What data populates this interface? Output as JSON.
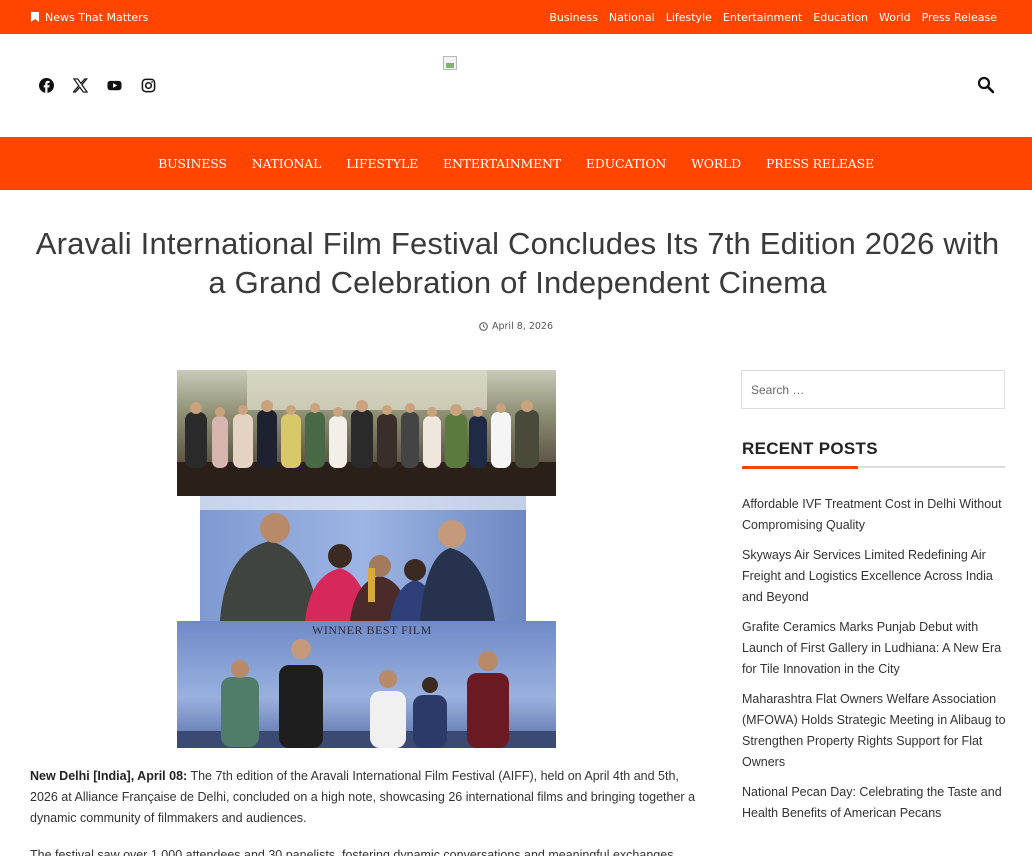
{
  "topbar": {
    "tagline": "News That Matters",
    "links": [
      "Business",
      "National",
      "Lifestyle",
      "Entertainment",
      "Education",
      "World",
      "Press Release"
    ]
  },
  "header": {
    "social_icons": [
      "facebook-icon",
      "x-icon",
      "youtube-icon",
      "instagram-icon"
    ],
    "logo_icon": "broken-image-icon",
    "search_icon": "search-icon"
  },
  "main_nav": {
    "items": [
      "BUSINESS",
      "NATIONAL",
      "LIFESTYLE",
      "ENTERTAINMENT",
      "EDUCATION",
      "WORLD",
      "PRESS RELEASE"
    ]
  },
  "article": {
    "title": "Aravali International Film Festival Concludes Its 7th Edition 2026 with a Grand Celebration of Independent Cinema",
    "date": "April 8, 2026",
    "lead_bold": "New Delhi [India], April 08:",
    "lead_text": " The 7th edition of the Aravali International Film Festival (AIFF), held on April 4th and 5th, 2026 at Alliance Française de Delhi, concluded on a high note, showcasing 26 international films and bringing together a dynamic community of filmmakers and audiences.",
    "para2": "The festival saw over 1,000 attendees and 30 panelists, fostering dynamic conversations and meaningful exchanges",
    "photo_banner_text": "WINNER  BEST FILM"
  },
  "sidebar": {
    "search_placeholder": "Search …",
    "recent_title": "RECENT POSTS",
    "recent_posts": [
      "Affordable IVF Treatment Cost in Delhi Without Compromising Quality",
      "Skyways Air Services Limited Redefining Air Freight and Logistics Excellence Across India and Beyond",
      "Grafite Ceramics Marks Punjab Debut with Launch of First Gallery in Ludhiana: A New Era for Tile Innovation in the City",
      "Maharashtra Flat Owners Welfare Association (MFOWA) Holds Strategic Meeting in Alibaug to Strengthen Property Rights Support for Flat Owners",
      "National Pecan Day: Celebrating the Taste and Health Benefits of American Pecans"
    ]
  },
  "colors": {
    "accent": "#ff4500",
    "text": "#333333",
    "title": "#3a3a3a"
  }
}
